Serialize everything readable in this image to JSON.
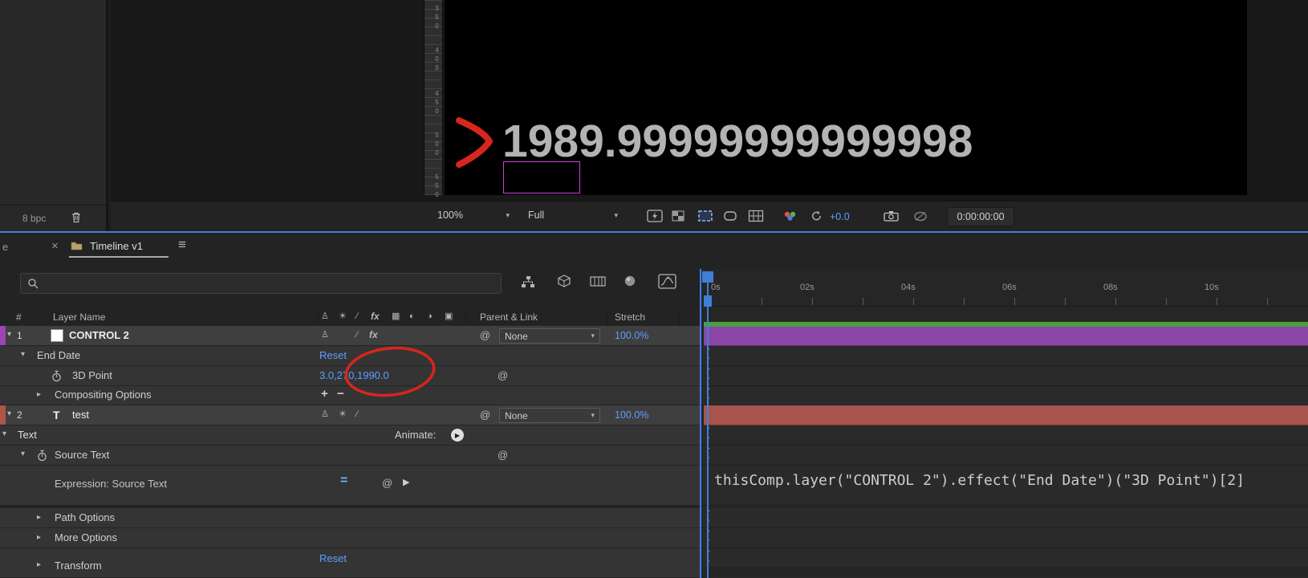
{
  "colors": {
    "value_blue": "#5e9eff",
    "playhead_blue": "#3f7fd6",
    "label_purple": "#8b46a8",
    "label_purple_strip": "#9c45b5",
    "label_brick": "#a6544d",
    "label_brick_strip": "#b0544a",
    "workarea_green": "#4aa03c",
    "annotation_red": "#d7261d"
  },
  "viewer": {
    "comp_text": "1989.99999999999998",
    "ruler_labels": [
      "350",
      "400",
      "450",
      "500",
      "550"
    ],
    "bpc_label": "8 bpc",
    "toolbar": {
      "zoom_value": "100%",
      "resolution_value": "Full",
      "exposure_value": "+0.0",
      "timecode": "0:00:00:00"
    }
  },
  "timeline": {
    "tabs": {
      "partial_label": "e",
      "close_glyph": "×",
      "active_label": "Timeline v1",
      "menu_glyph": "≡"
    },
    "ruler_labels": [
      "0s",
      "02s",
      "04s",
      "06s",
      "08s",
      "10s"
    ],
    "columns": {
      "number": "#",
      "layer_name": "Layer Name",
      "parent_link": "Parent & Link",
      "stretch": "Stretch"
    },
    "layers": {
      "layer1": {
        "number": "1",
        "name": "CONTROL 2",
        "parent": "None",
        "stretch": "100.0%"
      },
      "layer2": {
        "number": "2",
        "type_glyph": "T",
        "name": "test",
        "parent": "None",
        "stretch": "100.0%"
      }
    },
    "props": {
      "end_date": {
        "label": "End Date",
        "reset_label": "Reset"
      },
      "point3d": {
        "label": "3D Point",
        "value": "3.0,270,1990.0"
      },
      "compositing": {
        "label": "Compositing Options",
        "plus": "+",
        "minus": "−"
      },
      "text_group": {
        "label": "Text",
        "animate_label": "Animate:"
      },
      "source_text": {
        "label": "Source Text"
      },
      "expression": {
        "label": "Expression: Source Text",
        "code": "thisComp.layer(\"CONTROL 2\").effect(\"End Date\")(\"3D Point\")[2]"
      },
      "path_options": {
        "label": "Path Options"
      },
      "more_options": {
        "label": "More Options"
      },
      "transform": {
        "label": "Transform",
        "reset_label": "Reset"
      }
    }
  },
  "icons": {
    "chevron_down": "▾",
    "chevron_right": "▸",
    "dropdown_chevron": "▾",
    "pick_whip": "@",
    "fx": "fx",
    "quality": "∕",
    "cont_raster": "☀",
    "shy": "♙",
    "frame_blend": "▦",
    "motion_blur": "◐",
    "adjustment": "◑",
    "threed": "▣",
    "animate_play": "▶",
    "expression_enable": "=",
    "expression_graph": "▶",
    "bracket": "["
  }
}
